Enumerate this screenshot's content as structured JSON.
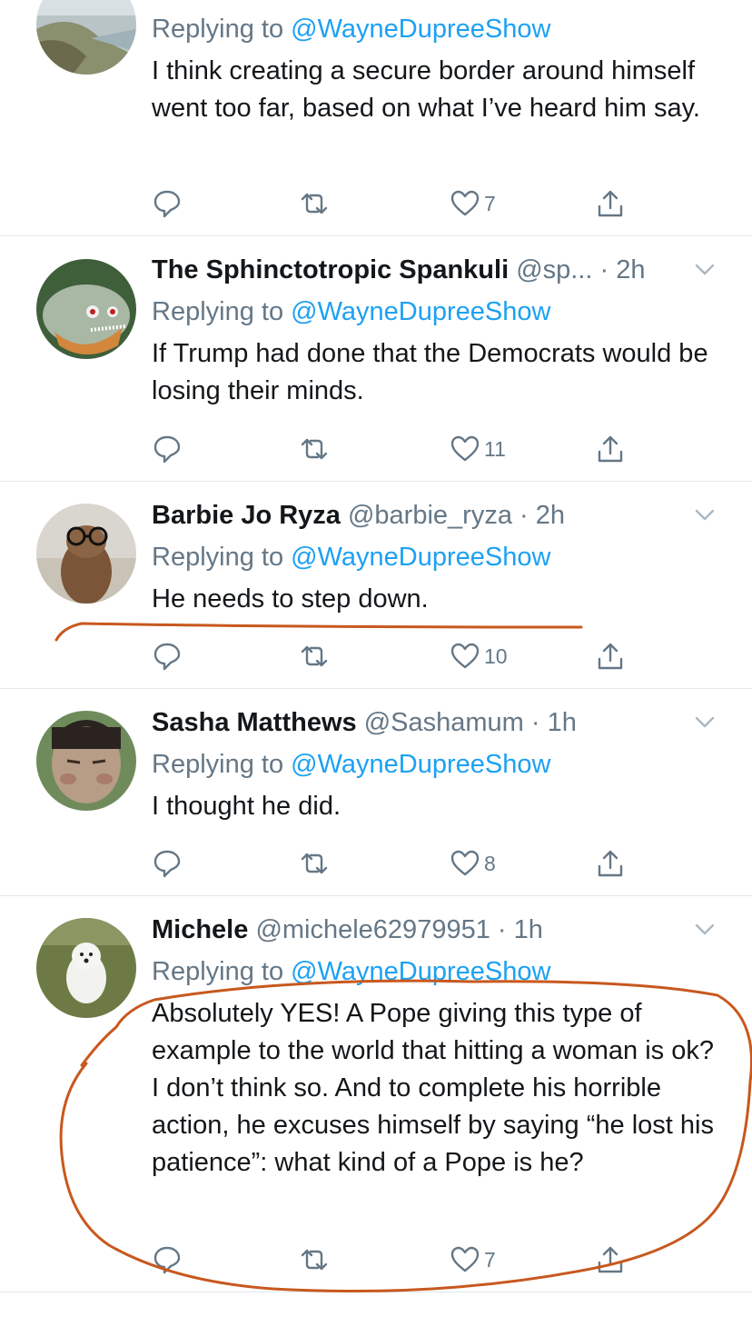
{
  "colors": {
    "link": "#1da1f2",
    "muted": "#657786",
    "text": "#14171a",
    "annotation": "#c8581e"
  },
  "tweets": [
    {
      "name": "",
      "handle": "",
      "time": "",
      "replying_prefix": "Replying to",
      "replying_handle": "@WayneDupreeShow",
      "text": "I think creating a secure border around himself went too far, based on what I’ve heard him say.",
      "likes": "7"
    },
    {
      "name": "The Sphinctotropic Spankuli",
      "handle": "@sp...",
      "time": "· 2h",
      "replying_prefix": "Replying to",
      "replying_handle": "@WayneDupreeShow",
      "text": "If Trump had done that the Democrats would be losing their minds.",
      "likes": "11"
    },
    {
      "name": "Barbie Jo Ryza",
      "handle": "@barbie_ryza",
      "time": "· 2h",
      "replying_prefix": "Replying to",
      "replying_handle": "@WayneDupreeShow",
      "text": "He needs to step down.",
      "likes": "10"
    },
    {
      "name": "Sasha Matthews",
      "handle": "@Sashamum",
      "time": "· 1h",
      "replying_prefix": "Replying to",
      "replying_handle": "@WayneDupreeShow",
      "text": "I thought he did.",
      "likes": "8"
    },
    {
      "name": "Michele",
      "handle": "@michele62979951",
      "time": "· 1h",
      "replying_prefix": "Replying to",
      "replying_handle": "@WayneDupreeShow",
      "text": "Absolutely YES! A Pope giving this type of example to the world that hitting a woman is ok? I don’t think so. And to complete his horrible action, he excuses himself by saying “he lost his patience”: what kind of a Pope is he?",
      "likes": "7"
    }
  ]
}
